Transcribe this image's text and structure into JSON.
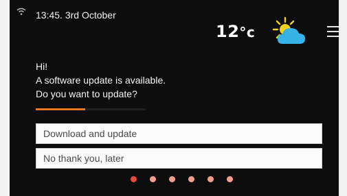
{
  "status": {
    "datetime": "13:45. 3rd October",
    "temperature": "12",
    "temperature_unit": "°c",
    "weather_icon": "partly-cloudy-icon",
    "wifi_icon": "wifi-icon",
    "menu_icon": "hamburger-menu-icon"
  },
  "message": {
    "line1": "Hi!",
    "line2": "A software update is available.",
    "line3": "Do you want to update?"
  },
  "progress": {
    "fraction": 0.45,
    "color": "#e8761e"
  },
  "options": [
    {
      "label": "Download and update"
    },
    {
      "label": "No thank you, later"
    }
  ],
  "pager": {
    "count": 6,
    "active_index": 0,
    "active_color": "#e84a3b",
    "inactive_color": "#f1a08f"
  }
}
